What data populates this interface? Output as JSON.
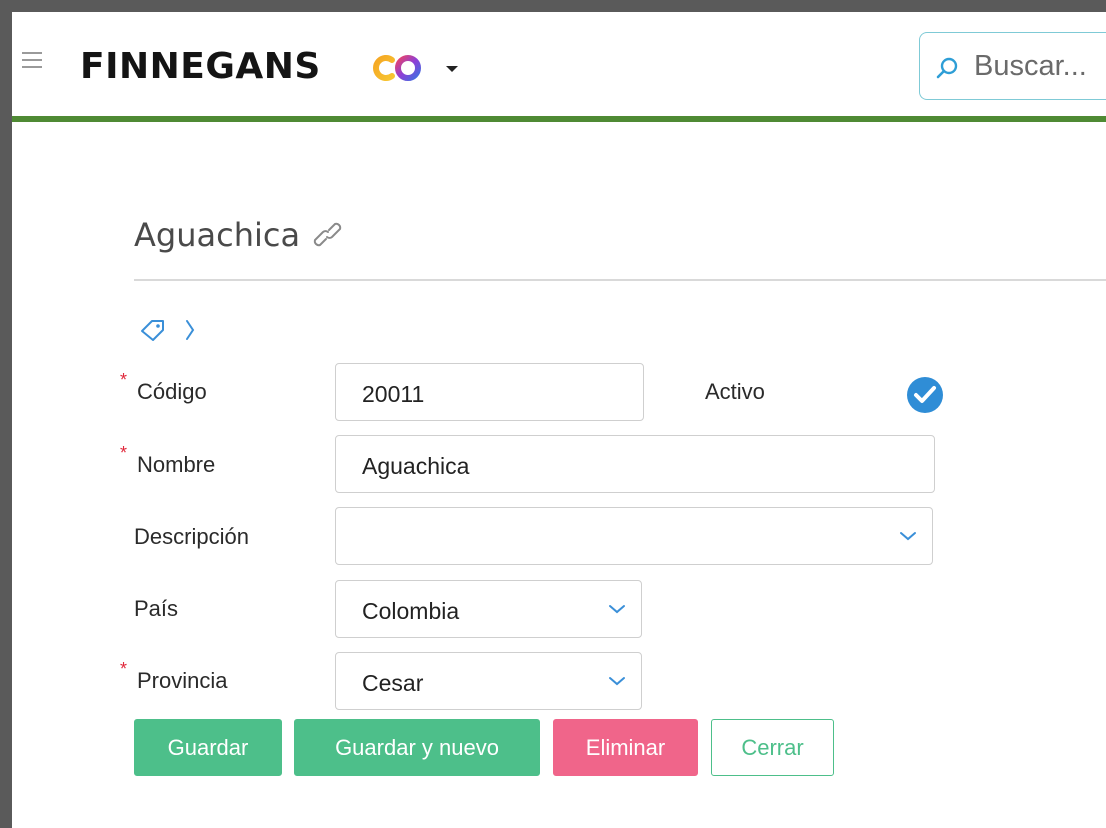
{
  "header": {
    "brand": "FINNEGANS",
    "search_placeholder": "Buscar..."
  },
  "page": {
    "title": "Aguachica"
  },
  "form": {
    "codigo": {
      "label": "Código",
      "value": "20011",
      "required": true
    },
    "activo": {
      "label": "Activo",
      "checked": true
    },
    "nombre": {
      "label": "Nombre",
      "value": "Aguachica",
      "required": true
    },
    "descripcion": {
      "label": "Descripción",
      "value": ""
    },
    "pais": {
      "label": "País",
      "value": "Colombia"
    },
    "provincia": {
      "label": "Provincia",
      "value": "Cesar",
      "required": true
    }
  },
  "buttons": {
    "guardar": "Guardar",
    "guardar_nuevo": "Guardar y nuevo",
    "eliminar": "Eliminar",
    "cerrar": "Cerrar"
  },
  "colors": {
    "header_accent": "#4f8a34",
    "primary_green": "#4dbf8a",
    "danger_pink": "#f0658a",
    "required_red": "#e0283b",
    "link_blue": "#3a8fd8"
  },
  "icons": [
    "menu-icon",
    "brand-logo",
    "caret-down-icon",
    "search-icon",
    "link-icon",
    "tag-icon",
    "chevron-right-icon",
    "chevron-down-icon",
    "check-circle-icon"
  ]
}
